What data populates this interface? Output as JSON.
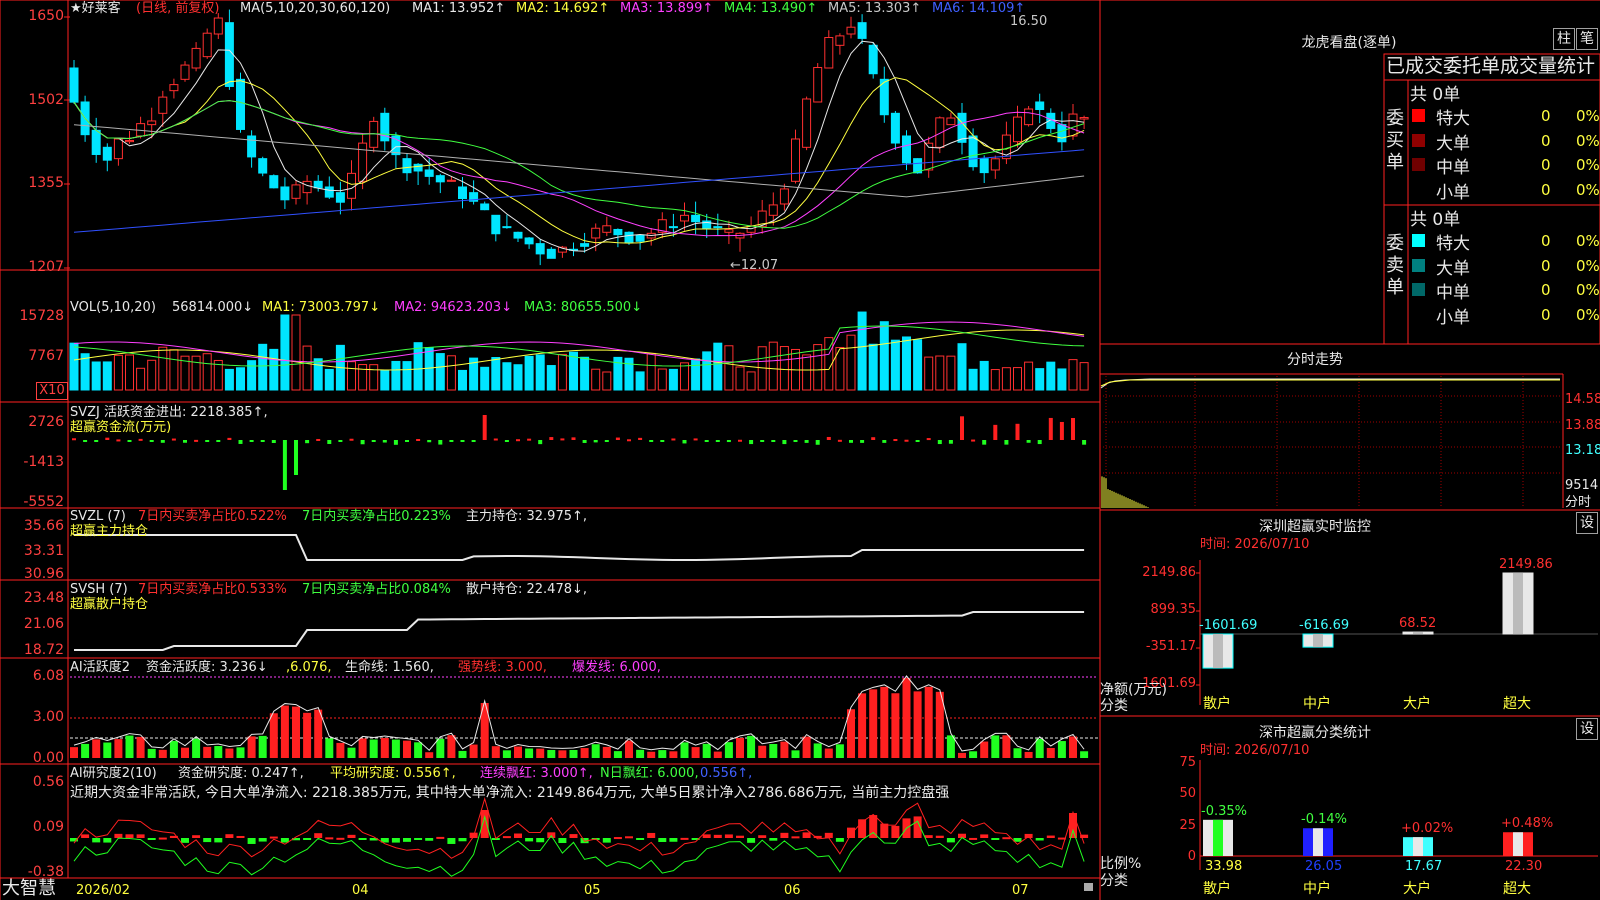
{
  "header": {
    "title_star": "★好莱客",
    "title_mode": "(日线, 前复权)",
    "ma_spec": "MA(5,10,20,30,60,120)",
    "ma_values": [
      {
        "label": "MA1:",
        "value": "13.952↑",
        "color": "#e8e8e8"
      },
      {
        "label": "MA2:",
        "value": "14.692↑",
        "color": "#ffff40"
      },
      {
        "label": "MA3:",
        "value": "13.899↑",
        "color": "#ff40ff"
      },
      {
        "label": "MA4:",
        "value": "13.490↑",
        "color": "#40ff40"
      },
      {
        "label": "MA5:",
        "value": "13.303↑",
        "color": "#c8c8c8"
      },
      {
        "label": "MA6:",
        "value": "14.109↑",
        "color": "#4060ff"
      }
    ],
    "high_label": "16.50",
    "low_label": "12.07"
  },
  "axes": {
    "price": [
      "1650",
      "1502",
      "1355",
      "1207"
    ],
    "vol": [
      "15728",
      "7767"
    ],
    "vol_unit": "X10",
    "svzj": [
      "2726",
      "-1413",
      "-5552"
    ],
    "svzl": [
      "35.66",
      "33.31",
      "30.96"
    ],
    "svsh": [
      "23.48",
      "21.06",
      "18.72"
    ],
    "ai1": [
      "6.08",
      "3.00",
      "0.00"
    ],
    "ai2": [
      "0.56",
      "0.09",
      "-0.38"
    ]
  },
  "vol_panel": {
    "spec": "VOL(5,10,20)",
    "vol": "56814.000↓",
    "ma1": "MA1: 73003.797↓",
    "ma2": "MA2: 94623.203↓",
    "ma3": "MA3: 80655.500↓"
  },
  "svzj_panel": {
    "label": "SVZJ  活跃资金进出: 2218.385↑,",
    "sub": "超赢资金流(万元)"
  },
  "svzl_panel": {
    "spec": "SVZL (7)",
    "a": "7日内买卖净占比0.522%",
    "b": "7日内买卖净占比0.223%",
    "c": "主力持仓: 32.975↑,",
    "sub": "超赢主力持仓"
  },
  "svsh_panel": {
    "spec": "SVSH (7)",
    "a": "7日内买卖净占比0.533%",
    "b": "7日内买卖净占比0.084%",
    "c": "散户持仓: 22.478↓,",
    "sub": "超赢散户持仓"
  },
  "ai1_panel": {
    "spec": "AI活跃度2",
    "a": "资金活跃度: 3.236↓",
    "b": ",6.076,",
    "c": "生命线: 1.560,",
    "d": "强势线: 3.000,",
    "e": "爆发线: 6.000,"
  },
  "ai2_panel": {
    "spec": "AI研究度2(10)",
    "a": "资金研究度: 0.247↑,",
    "b": "平均研究度: 0.556↑,",
    "c": "连续飘红: 3.000↑,",
    "d": "N日飘红: 6.000,",
    "e": "0.556↑,",
    "note": "近期大资金非常活跃, 今日大单净流入: 2218.385万元, 其中特大单净流入: 2149.864万元, 大单5日累计净入2786.686万元, 当前主力控盘强"
  },
  "bottom": {
    "brand": "大智慧",
    "dates": [
      "2026/02",
      "04",
      "05",
      "06",
      "07"
    ]
  },
  "lhb": {
    "title": "龙虎看盘(逐单)",
    "btn1": "柱",
    "btn2": "笔",
    "subtitle": "已成交委托单成交量统计",
    "buy_label": "委买单",
    "sell_label": "委卖单",
    "buy_total": "共 0单",
    "sell_total": "共 0单",
    "buy_rows": [
      {
        "name": "特大",
        "count": "0",
        "pct": "0%",
        "color": "#ff0000"
      },
      {
        "name": "大单",
        "count": "0",
        "pct": "0%",
        "color": "#900000"
      },
      {
        "name": "中单",
        "count": "0",
        "pct": "0%",
        "color": "#700000"
      },
      {
        "name": "小单",
        "count": "0",
        "pct": "0%",
        "color": ""
      }
    ],
    "sell_rows": [
      {
        "name": "特大",
        "count": "0",
        "pct": "0%",
        "color": "#00ffff"
      },
      {
        "name": "大单",
        "count": "0",
        "pct": "0%",
        "color": "#008080"
      },
      {
        "name": "中单",
        "count": "0",
        "pct": "0%",
        "color": "#006868"
      },
      {
        "name": "小单",
        "count": "0",
        "pct": "0%",
        "color": ""
      }
    ]
  },
  "fenshi": {
    "title": "分时走势",
    "p1": "14.58",
    "p2": "13.88",
    "p3": "13.18",
    "vol": "9514",
    "vol_lbl": "分时"
  },
  "monitor": {
    "title": "深圳超赢实时监控",
    "btn": "设",
    "time": "时间: 2026/07/10",
    "ticks": [
      "2149.86",
      "899.35",
      "-351.17",
      "-1601.69"
    ],
    "ylabel": "净额(万元)",
    "xlabel": "分类",
    "bars": [
      {
        "cat": "散户",
        "value": -1601.69,
        "label": "-1601.69"
      },
      {
        "cat": "中户",
        "value": -616.69,
        "label": "-616.69"
      },
      {
        "cat": "大户",
        "value": 68.52,
        "label": "68.52"
      },
      {
        "cat": "超大",
        "value": 2149.86,
        "label": "2149.86"
      }
    ]
  },
  "classify": {
    "title": "深市超赢分类统计",
    "btn": "设",
    "time": "时间: 2026/07/10",
    "ticks": [
      "75",
      "50",
      "25",
      "0"
    ],
    "ylabel": "比例%",
    "xlabel": "分类",
    "bars": [
      {
        "cat": "散户",
        "value": 33.98,
        "label": "33.98",
        "chg": "-0.35%"
      },
      {
        "cat": "中户",
        "value": 26.05,
        "label": "26.05",
        "chg": "-0.14%"
      },
      {
        "cat": "大户",
        "value": 17.67,
        "label": "17.67",
        "chg": "+0.02%"
      },
      {
        "cat": "超大",
        "value": 22.3,
        "label": "22.30",
        "chg": "+0.48%"
      }
    ]
  }
}
